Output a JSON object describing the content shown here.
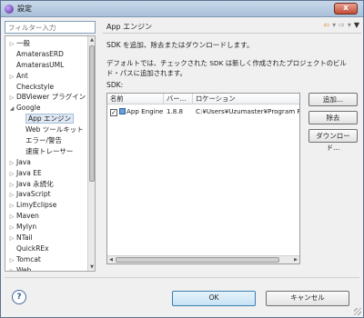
{
  "window": {
    "title": "設定",
    "close_label": "x"
  },
  "left": {
    "filter_placeholder": "フィルター入力",
    "tree": [
      {
        "label": "一般",
        "level": 1,
        "expandable": true,
        "expanded": false
      },
      {
        "label": "AmaterasERD",
        "level": 1,
        "expandable": false
      },
      {
        "label": "AmaterasUML",
        "level": 1,
        "expandable": false
      },
      {
        "label": "Ant",
        "level": 1,
        "expandable": true,
        "expanded": false
      },
      {
        "label": "Checkstyle",
        "level": 1,
        "expandable": false
      },
      {
        "label": "DBViewer プラグイン",
        "level": 1,
        "expandable": true,
        "expanded": false
      },
      {
        "label": "Google",
        "level": 1,
        "expandable": true,
        "expanded": true
      },
      {
        "label": "App エンジン",
        "level": 2,
        "expandable": false,
        "selected": true
      },
      {
        "label": "Web ツールキット",
        "level": 2,
        "expandable": false
      },
      {
        "label": "エラー/警告",
        "level": 2,
        "expandable": false
      },
      {
        "label": "速度トレーサー",
        "level": 2,
        "expandable": false
      },
      {
        "label": "Java",
        "level": 1,
        "expandable": true,
        "expanded": false
      },
      {
        "label": "Java EE",
        "level": 1,
        "expandable": true,
        "expanded": false
      },
      {
        "label": "Java 永続化",
        "level": 1,
        "expandable": true,
        "expanded": false
      },
      {
        "label": "JavaScript",
        "level": 1,
        "expandable": true,
        "expanded": false
      },
      {
        "label": "LimyEclipse",
        "level": 1,
        "expandable": true,
        "expanded": false
      },
      {
        "label": "Maven",
        "level": 1,
        "expandable": true,
        "expanded": false
      },
      {
        "label": "Mylyn",
        "level": 1,
        "expandable": true,
        "expanded": false
      },
      {
        "label": "NTail",
        "level": 1,
        "expandable": true,
        "expanded": false
      },
      {
        "label": "QuickREx",
        "level": 1,
        "expandable": false
      },
      {
        "label": "Tomcat",
        "level": 1,
        "expandable": true,
        "expanded": false
      },
      {
        "label": "Web",
        "level": 1,
        "expandable": true,
        "expanded": false
      }
    ]
  },
  "page": {
    "title": "App エンジン",
    "description": "SDK を追加、除去またはダウンロードします。",
    "note": "デフォルトでは、チェックされた SDK は新しく作成されたプロジェクトのビルド・パスに追加されます。",
    "sdk_label": "SDK:",
    "columns": [
      "名前",
      "バー...",
      "ロケーション"
    ],
    "rows": [
      {
        "checked": true,
        "name": "App Engine",
        "version": "1.8.8",
        "location": "C:¥Users¥Uzumaster¥Program Files"
      }
    ],
    "buttons": {
      "add": "追加...",
      "remove": "除去",
      "download": "ダウンロード..."
    }
  },
  "footer": {
    "help": "?",
    "ok": "OK",
    "cancel": "キャンセル"
  },
  "icons": {
    "back": "back-arrow-icon",
    "forward": "forward-arrow-icon",
    "menu": "chevron-down-icon"
  }
}
